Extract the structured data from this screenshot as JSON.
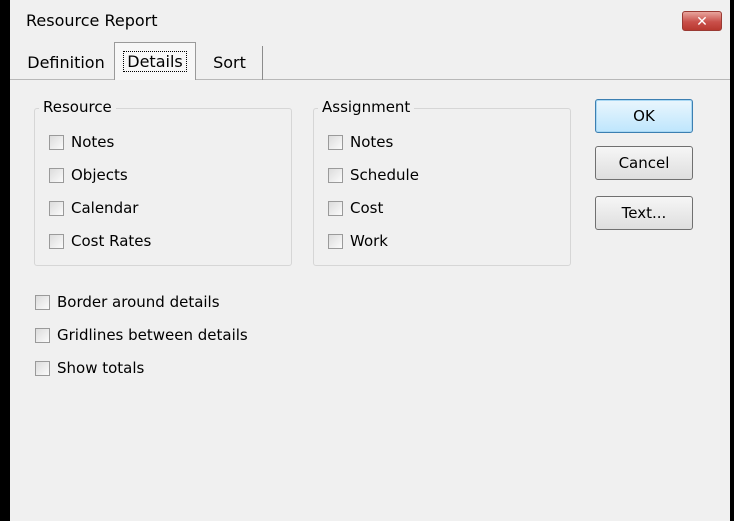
{
  "window": {
    "title": "Resource Report"
  },
  "tabs": [
    {
      "label": "Definition"
    },
    {
      "label": "Details"
    },
    {
      "label": "Sort"
    }
  ],
  "resource_group": {
    "legend": "Resource",
    "items": [
      {
        "label": "Notes",
        "checked": false
      },
      {
        "label": "Objects",
        "checked": false
      },
      {
        "label": "Calendar",
        "checked": false
      },
      {
        "label": "Cost Rates",
        "checked": false
      }
    ]
  },
  "assignment_group": {
    "legend": "Assignment",
    "items": [
      {
        "label": "Notes",
        "checked": false
      },
      {
        "label": "Schedule",
        "checked": false
      },
      {
        "label": "Cost",
        "checked": false
      },
      {
        "label": "Work",
        "checked": false
      }
    ]
  },
  "options": [
    {
      "label": "Border around details",
      "checked": false
    },
    {
      "label": "Gridlines between details",
      "checked": false
    },
    {
      "label": "Show totals",
      "checked": false
    }
  ],
  "buttons": {
    "ok": "OK",
    "cancel": "Cancel",
    "text": "Text..."
  },
  "icons": {
    "close": "close-x-icon",
    "close_glyph": "✕"
  },
  "colors": {
    "close_button": "#c9504a",
    "default_button_border": "#3c7fb1"
  }
}
